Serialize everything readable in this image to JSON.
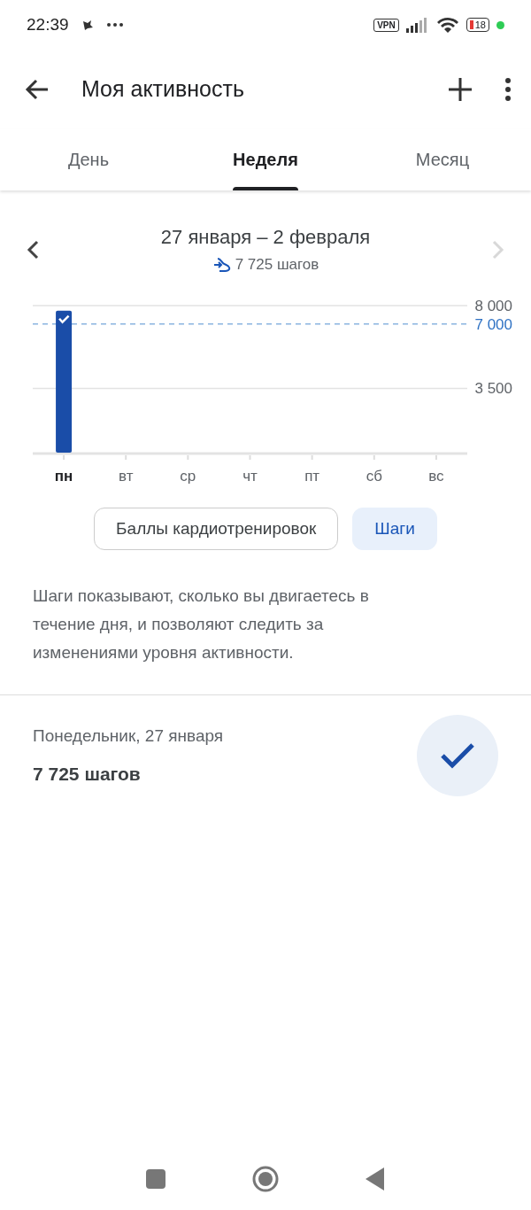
{
  "status_bar": {
    "time": "22:39",
    "vpn": "VPN",
    "battery": "18"
  },
  "toolbar": {
    "title": "Моя активность"
  },
  "tabs": [
    {
      "label": "День",
      "selected": false
    },
    {
      "label": "Неделя",
      "selected": true
    },
    {
      "label": "Месяц",
      "selected": false
    }
  ],
  "period": {
    "title": "27 января – 2 февраля",
    "total": "7 725 шагов",
    "next_disabled": true
  },
  "chart_data": {
    "type": "bar",
    "categories": [
      "пн",
      "вт",
      "ср",
      "чт",
      "пт",
      "сб",
      "вс"
    ],
    "values": [
      7725,
      null,
      null,
      null,
      null,
      null,
      null
    ],
    "ylim": [
      0,
      8000
    ],
    "yticks": [
      {
        "value": 3500,
        "label": "3 500"
      },
      {
        "value": 8000,
        "label": "8 000"
      }
    ],
    "ref_lines": [
      {
        "axis": "y",
        "value": 7000,
        "label": "7 000"
      }
    ]
  },
  "chips": [
    {
      "label": "Баллы кардиотренировок",
      "selected": false
    },
    {
      "label": "Шаги",
      "selected": true
    }
  ],
  "description": "Шаги показывают, сколько вы двигаетесь в течение дня, и позволяют следить за изменениями уровня активности.",
  "day": {
    "date": "Понедельник, 27 января",
    "steps": "7 725 шагов",
    "goal_met": true
  }
}
